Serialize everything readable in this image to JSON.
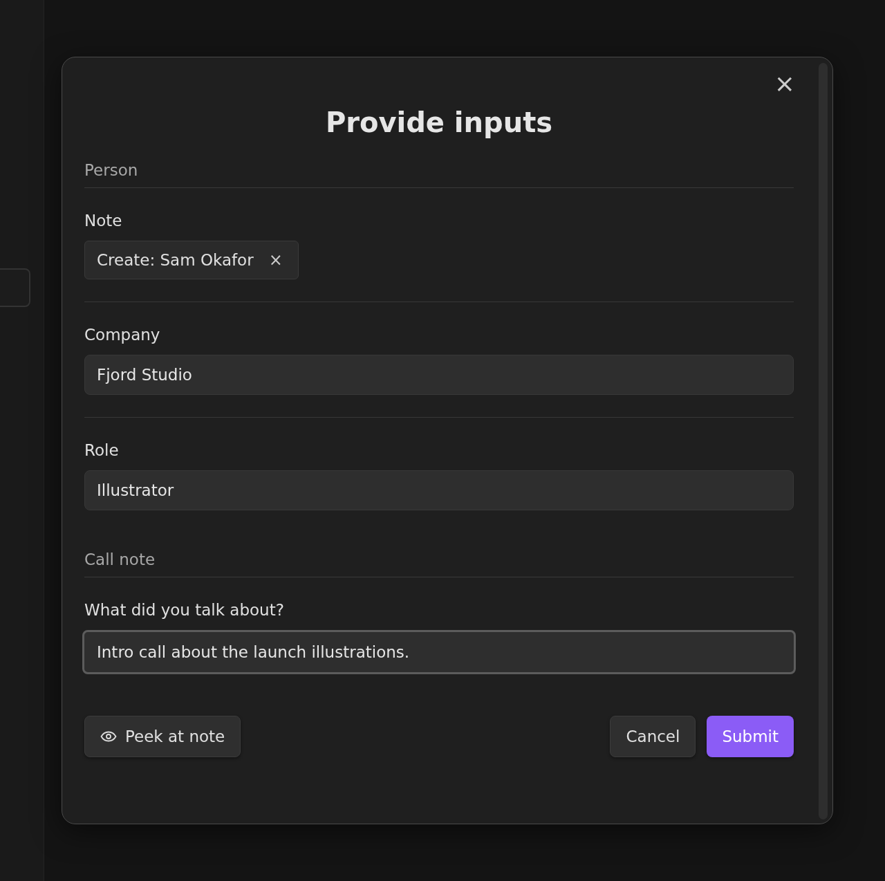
{
  "dialog": {
    "title": "Provide inputs",
    "close_label": "×",
    "sections": [
      {
        "heading": "Person",
        "fields": [
          {
            "kind": "chips",
            "label": "Note",
            "chips": [
              {
                "text": "Create: Sam Okafor",
                "remove": "×"
              }
            ]
          },
          {
            "kind": "text",
            "label": "Company",
            "value": "Fjord Studio",
            "focused": false
          },
          {
            "kind": "text",
            "label": "Role",
            "value": "Illustrator",
            "focused": false
          }
        ]
      },
      {
        "heading": "Call note",
        "fields": [
          {
            "kind": "text",
            "label": "What did you talk about?",
            "value": "Intro call about the launch illustrations.",
            "focused": true
          }
        ]
      }
    ],
    "buttons": [
      {
        "kind": "preview",
        "label": "Peek at note"
      },
      {
        "kind": "secondary",
        "label": "Cancel"
      },
      {
        "kind": "primary",
        "label": "Submit"
      }
    ]
  }
}
